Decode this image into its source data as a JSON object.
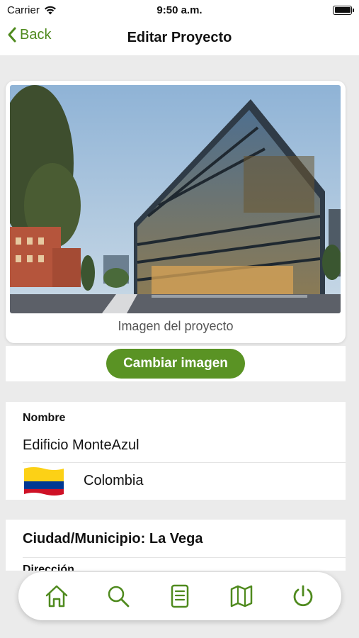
{
  "status": {
    "carrier": "Carrier",
    "time": "9:50 a.m."
  },
  "nav": {
    "back_label": "Back",
    "title": "Editar Proyecto"
  },
  "project_image": {
    "caption": "Imagen del proyecto"
  },
  "actions": {
    "change_image_label": "Cambiar imagen"
  },
  "form": {
    "name_label": "Nombre",
    "name_value": "Edificio MonteAzul",
    "country": "Colombia",
    "city_line": "Ciudad/Municipio: La Vega",
    "next_label_cut": "Dirección"
  },
  "tabs": [
    {
      "icon": "home-icon"
    },
    {
      "icon": "search-icon"
    },
    {
      "icon": "document-icon"
    },
    {
      "icon": "map-icon"
    },
    {
      "icon": "power-icon"
    }
  ],
  "colors": {
    "accent": "#5a9324",
    "accent_text": "#4f8a1e",
    "background": "#ebebeb"
  }
}
